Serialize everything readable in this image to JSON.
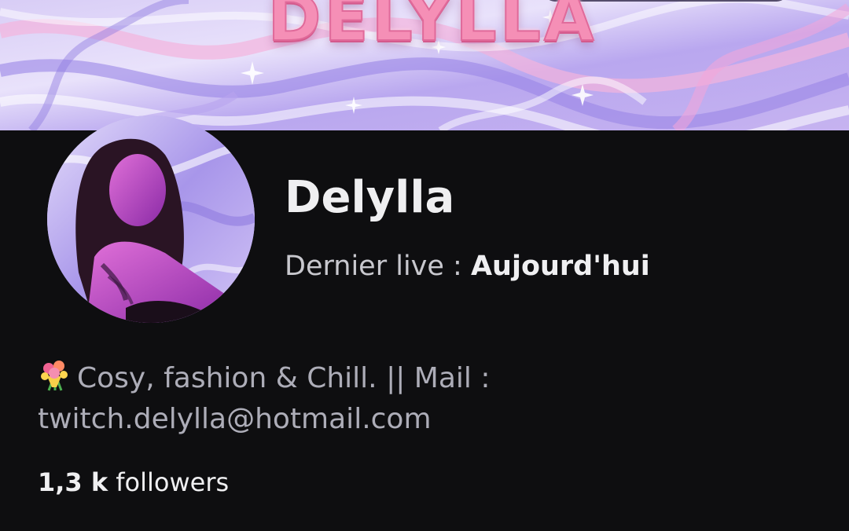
{
  "banner": {
    "title": "DELYLLA"
  },
  "profile": {
    "channel_name": "Delylla",
    "last_live_label": "Dernier live : ",
    "last_live_value": "Aujourd'hui",
    "bio_line_1": "Cosy, fashion & Chill.  || Mail :",
    "bio_line_2": "twitch.delylla@hotmail.com",
    "bio_icon": "bouquet-icon",
    "followers_count": "1,3 k",
    "followers_label": "followers"
  },
  "colors": {
    "background": "#0e0e10",
    "banner_gradient_light": "#e9e2fb",
    "banner_gradient_pink": "#f4a6d8",
    "banner_gradient_violet": "#9a86e6",
    "title_pink": "#f58fb6",
    "text_primary": "#efeff1",
    "text_secondary": "#adadb8"
  }
}
